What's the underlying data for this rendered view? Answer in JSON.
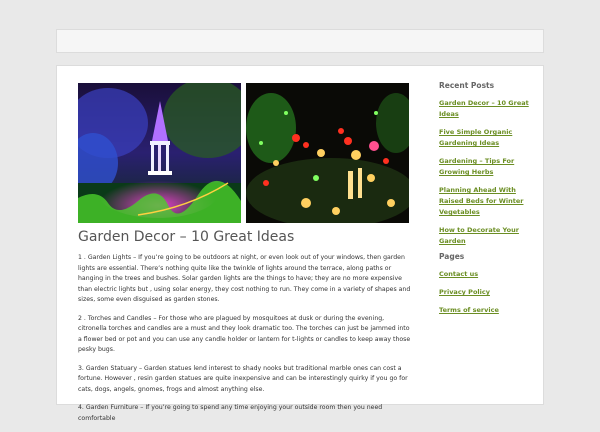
{
  "post": {
    "title": "Garden Decor – 10 Great Ideas",
    "paragraphs": [
      "1 . Garden Lights – If you’re going to be outdoors at night, or even look out of your windows, then garden lights are essential. There’s nothing quite like the twinkle of lights around the terrace, along paths or hanging in the trees and bushes. Solar garden lights are the things to have; they are no more expensive than electric lights but , using solar energy, they cost nothing to run. They come in a variety of shapes and sizes, some even disguised as garden stones.",
      "2 . Torches and Candles – For those who are plagued by mosquitoes at dusk or during the evening, citronella torches and candles are a must and they look dramatic too. The torches can just be jammed into a flower bed or pot and you can use any candle holder or lantern for t-lights or candles to keep away those pesky bugs.",
      "3. Garden Statuary – Garden statues lend interest to shady nooks but traditional marble ones can cost a fortune. However , resin garden statues are quite inexpensive and can be interestingly quirky if you go for cats, dogs, angels, gnomes, frogs and almost anything else.",
      "4. Garden Furniture – If you’re going to spend any time enjoying your outside room then you need comfortable"
    ]
  },
  "sidebar": {
    "recent_heading": "Recent Posts",
    "recent_posts": [
      "Garden Decor – 10 Great Ideas",
      "Five Simple Organic Gardening Ideas",
      "Gardening – Tips For Growing Herbs",
      "Planning Ahead With Raised Beds for Winter Vegetables",
      "How to Decorate Your Garden"
    ],
    "pages_heading": "Pages",
    "pages": [
      "Contact us",
      "Privacy Policy",
      "Terms of service"
    ]
  },
  "colors": {
    "background": "#e9e9e9",
    "link": "#6b8e23",
    "title": "#555555"
  }
}
